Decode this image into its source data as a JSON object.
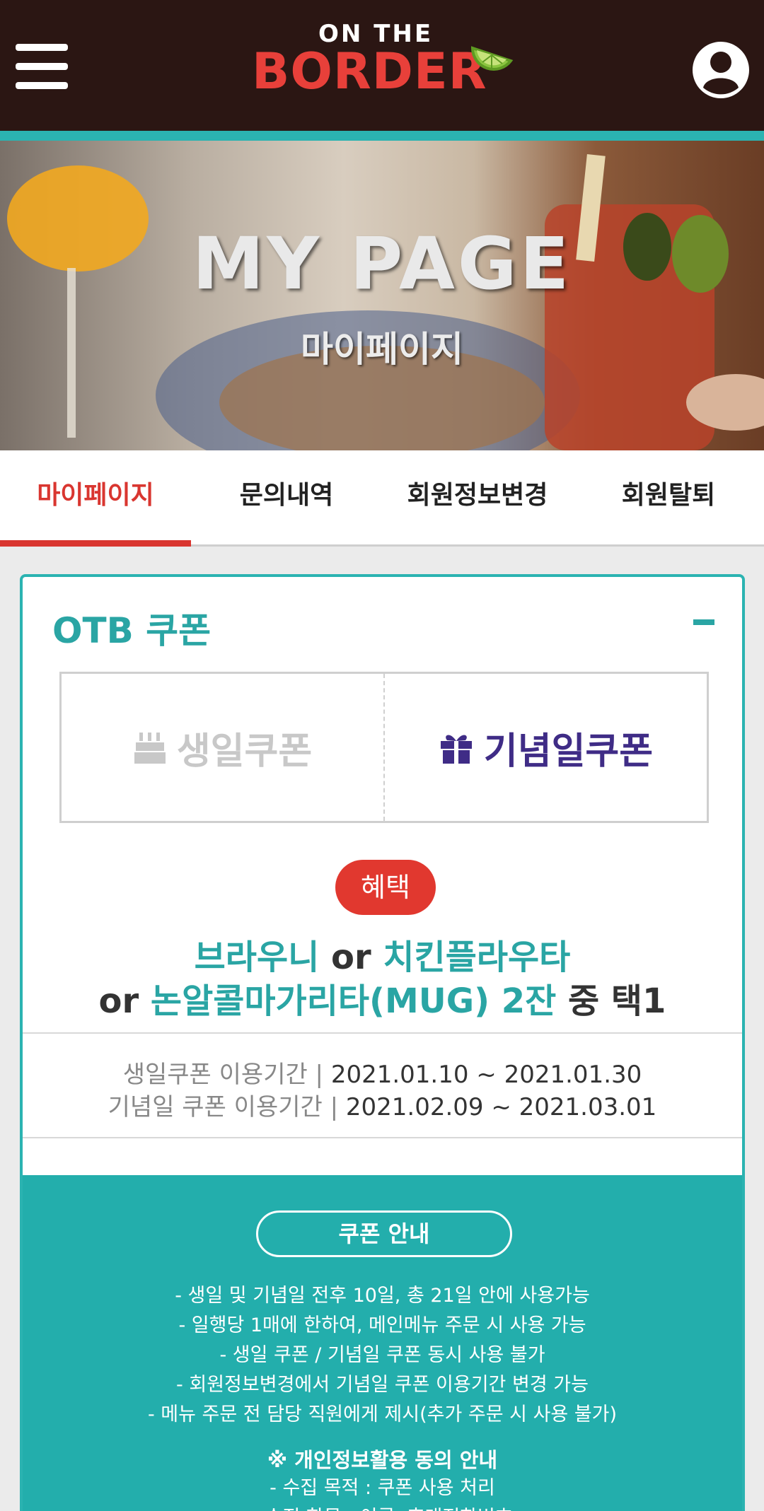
{
  "header": {
    "logo_top": "ON THE",
    "logo_main": "BORDER",
    "menu_icon": "hamburger-menu-icon",
    "profile_icon": "user-profile-icon"
  },
  "hero": {
    "title": "MY PAGE",
    "subtitle": "마이페이지"
  },
  "tabs": [
    {
      "label": "마이페이지",
      "active": true
    },
    {
      "label": "문의내역",
      "active": false
    },
    {
      "label": "회원정보변경",
      "active": false
    },
    {
      "label": "회원탈퇴",
      "active": false
    }
  ],
  "coupon": {
    "section_title": "OTB 쿠폰",
    "collapse_symbol": "-",
    "birthday_tab": "생일쿠폰",
    "anniversary_tab": "기념일쿠폰",
    "benefit_badge": "혜택",
    "benefit_item1": "브라우니",
    "or1": "or",
    "benefit_item2": "치킨플라우타",
    "or2": "or",
    "benefit_item3": "논알콜마가리타(MUG) 2잔",
    "choose": "중 택1",
    "birthday_period_label": "생일쿠폰 이용기간 |",
    "birthday_period": "2021.01.10 ~ 2021.01.30",
    "anniversary_period_label": "기념일 쿠폰 이용기간 |",
    "anniversary_period": "2021.02.09 ~ 2021.03.01"
  },
  "info": {
    "button_label": "쿠폰 안내",
    "notes": [
      "- 생일 및 기념일 전후 10일, 총 21일 안에 사용가능",
      "- 일행당 1매에 한하여, 메인메뉴 주문 시 사용 가능",
      "- 생일 쿠폰 / 기념일 쿠폰 동시 사용 불가",
      "- 회원정보변경에서 기념일 쿠폰 이용기간 변경 가능",
      "- 메뉴 주문 전 담당 직원에게 제시(추가 주문 시 사용 불가)"
    ],
    "consent_title": "※ 개인정보활용 동의 안내",
    "consent_items": [
      "- 수집 목적 : 쿠폰 사용 처리",
      "- 수집 항목 : 이름, 휴대전화번호"
    ]
  },
  "colors": {
    "header_bg": "#2b1613",
    "teal": "#2bb3b1",
    "red": "#d93630",
    "purple": "#3f2c86"
  }
}
